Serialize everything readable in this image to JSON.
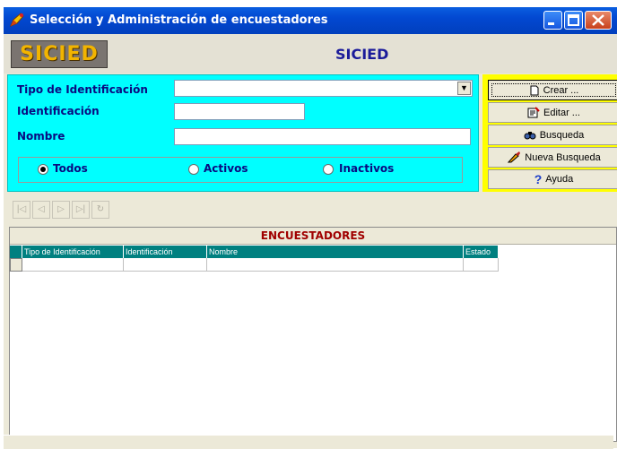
{
  "window": {
    "title": "Selección y Administración de encuestadores"
  },
  "brand": {
    "logo_text": "SICIED",
    "app_name": "SICIED"
  },
  "filters": {
    "tipo_label": "Tipo de Identificación",
    "tipo_value": "",
    "identificacion_label": "Identificación",
    "identificacion_value": "",
    "nombre_label": "Nombre",
    "nombre_value": "",
    "status_options": [
      {
        "label": "Todos",
        "checked": true
      },
      {
        "label": "Activos",
        "checked": false
      },
      {
        "label": "Inactivos",
        "checked": false
      }
    ]
  },
  "actions": {
    "crear": "Crear ...",
    "editar": "Editar ...",
    "busqueda": "Busqueda",
    "nueva_busqueda": "Nueva Busqueda",
    "ayuda": "Ayuda"
  },
  "nav": {
    "first": "|◁",
    "prev": "◁",
    "next": "▷",
    "last": "▷|",
    "refresh": "↻"
  },
  "grid": {
    "title": "ENCUESTADORES",
    "columns": [
      "Tipo de Identificación",
      "Identificación",
      "Nombre",
      "Estado"
    ]
  },
  "colors": {
    "search_panel_bg": "#00ffff",
    "actions_panel_bg": "#ffff00",
    "header_teal": "#008080",
    "grid_title_red": "#a00000"
  }
}
